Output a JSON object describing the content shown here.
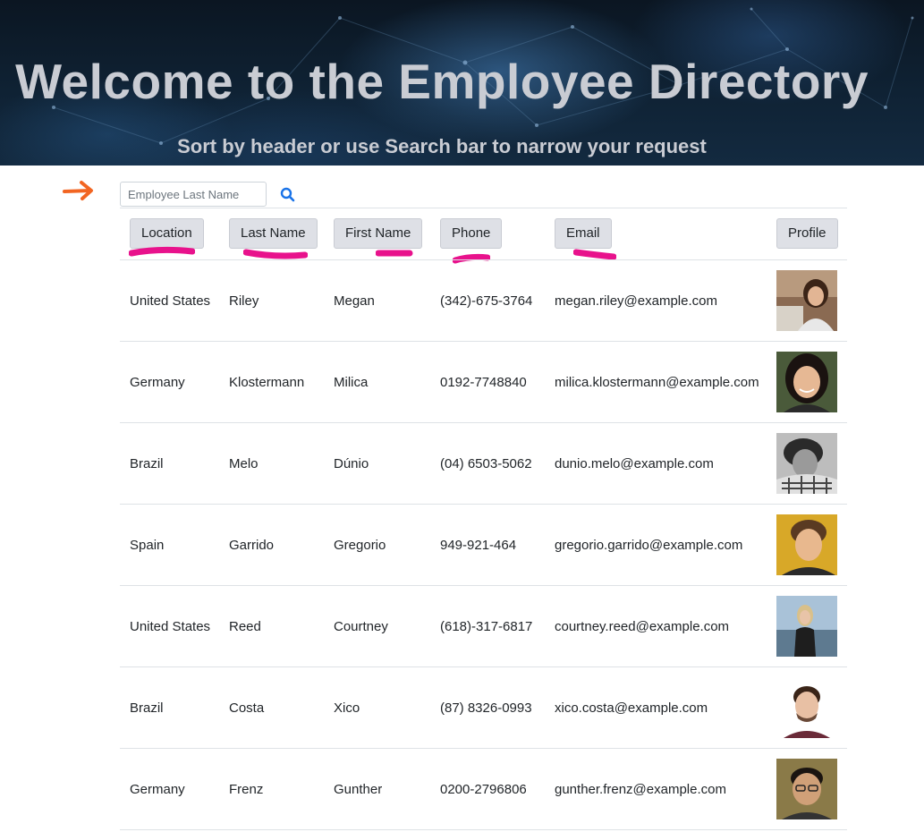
{
  "header": {
    "title": "Welcome to the Employee Directory",
    "subtitle": "Sort by header or use Search bar to narrow your request"
  },
  "search": {
    "placeholder": "Employee Last Name",
    "value": ""
  },
  "icons": {
    "annotation_arrow": "arrow-right-icon",
    "search": "search-icon",
    "annotation_color_arrow": "#f26522",
    "annotation_color_underline": "#e8128c"
  },
  "table": {
    "columns": [
      "Location",
      "Last Name",
      "First Name",
      "Phone",
      "Email",
      "Profile"
    ],
    "rows": [
      {
        "location": "United States",
        "last": "Riley",
        "first": "Megan",
        "phone": "(342)-675-3764",
        "email": "megan.riley@example.com"
      },
      {
        "location": "Germany",
        "last": "Klostermann",
        "first": "Milica",
        "phone": "0192-7748840",
        "email": "milica.klostermann@example.com"
      },
      {
        "location": "Brazil",
        "last": "Melo",
        "first": "Dúnio",
        "phone": "(04) 6503-5062",
        "email": "dunio.melo@example.com"
      },
      {
        "location": "Spain",
        "last": "Garrido",
        "first": "Gregorio",
        "phone": "949-921-464",
        "email": "gregorio.garrido@example.com"
      },
      {
        "location": "United States",
        "last": "Reed",
        "first": "Courtney",
        "phone": "(618)-317-6817",
        "email": "courtney.reed@example.com"
      },
      {
        "location": "Brazil",
        "last": "Costa",
        "first": "Xico",
        "phone": "(87) 8326-0993",
        "email": "xico.costa@example.com"
      },
      {
        "location": "Germany",
        "last": "Frenz",
        "first": "Gunther",
        "phone": "0200-2796806",
        "email": "gunther.frenz@example.com"
      }
    ]
  }
}
